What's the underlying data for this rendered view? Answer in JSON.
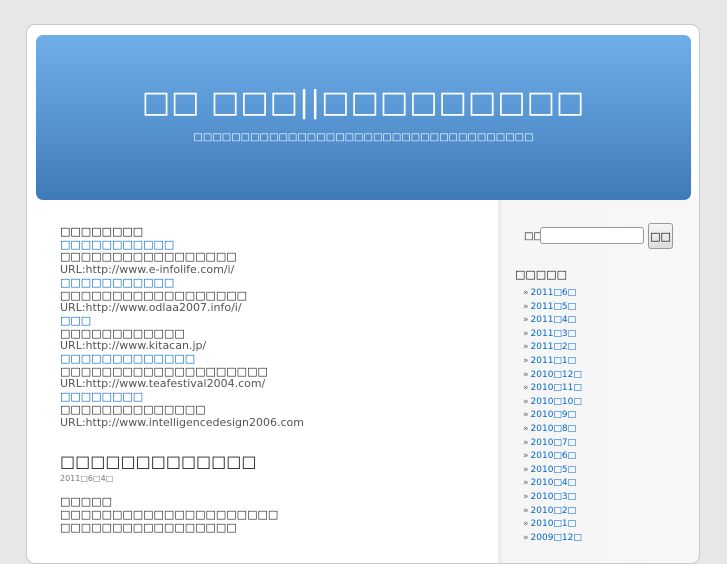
{
  "header": {
    "title": "□□ □□□||□□□□□□□□□",
    "description": "□□□□□□□□□□□□□□□□□□□□□□□□□□□□□□□□□□□□"
  },
  "links": {
    "heading": "□□□□□□□□",
    "items": [
      {
        "title": "□□□□□□□□□□□",
        "desc": "□□□□□□□□□□□□□□□□□",
        "url": "URL:http://www.e-infolife.com/i/"
      },
      {
        "title": "□□□□□□□□□□□",
        "desc": "□□□□□□□□□□□□□□□□□□",
        "url": "URL:http://www.odlaa2007.info/i/"
      },
      {
        "title": "□□□",
        "desc": "□□□□□□□□□□□□",
        "url": "URL:http://www.kitacan.jp/"
      },
      {
        "title": "□□□□□□□□□□□□□",
        "desc": "□□□□□□□□□□□□□□□□□□□□",
        "url": "URL:http://www.teafestival2004.com/"
      },
      {
        "title": "□□□□□□□□",
        "desc": "□□□□□□□□□□□□□□",
        "url": "URL:http://www.intelligencedesign2006.com"
      }
    ]
  },
  "post": {
    "title": "□□□□□□□□□□□□□",
    "date": "2011□6□4□",
    "lines": [
      "□□□□□",
      "□□□□□□□□□□□□□□□□□□□□□",
      "□□□□□□□□□□□□□□□□□"
    ]
  },
  "sidebar": {
    "search_label": "□□:",
    "search_value": "",
    "search_button": "□□",
    "archives_title": "□□□□□",
    "archives": [
      "2011□6□",
      "2011□5□",
      "2011□4□",
      "2011□3□",
      "2011□2□",
      "2011□1□",
      "2010□12□",
      "2010□11□",
      "2010□10□",
      "2010□9□",
      "2010□8□",
      "2010□7□",
      "2010□6□",
      "2010□5□",
      "2010□4□",
      "2010□3□",
      "2010□2□",
      "2010□1□",
      "2009□12□"
    ]
  }
}
